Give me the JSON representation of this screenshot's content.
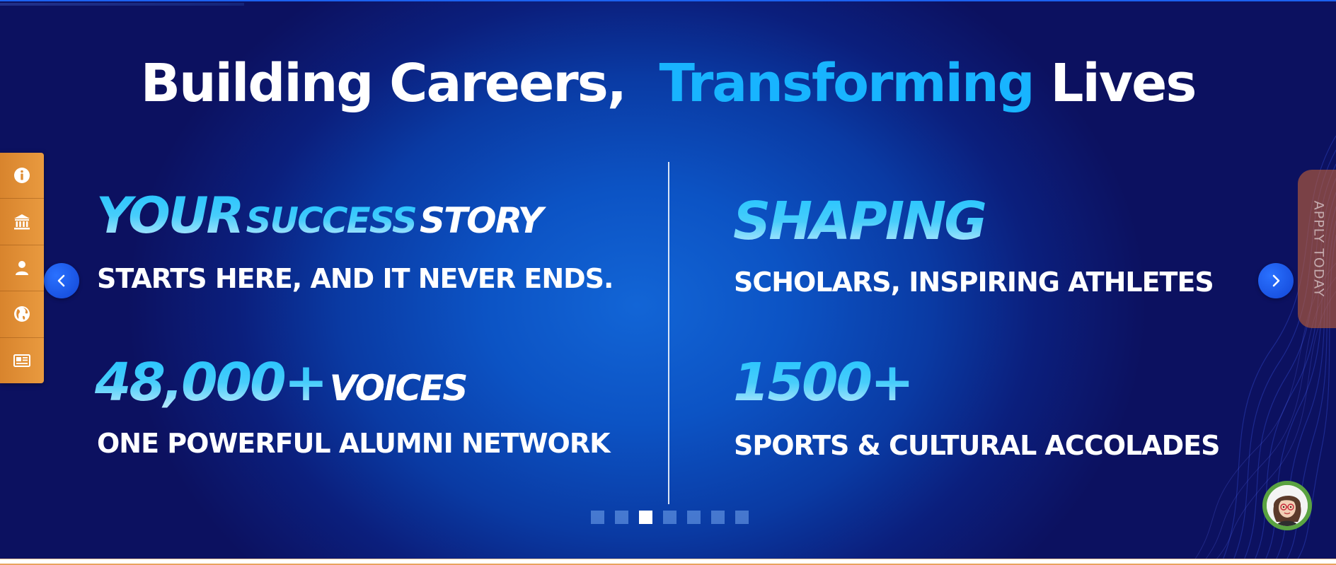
{
  "hero": {
    "headline": {
      "part1": "Building Careers,",
      "accent": "Transforming",
      "part2": "Lives"
    },
    "left": {
      "stat1": {
        "word1": "YOUR",
        "word2": "SUCCESS",
        "word3": "STORY",
        "subtitle": "STARTS HERE, AND IT NEVER ENDS."
      },
      "stat2": {
        "big": "48,000+",
        "word": "VOICES",
        "subtitle": "ONE POWERFUL ALUMNI NETWORK"
      }
    },
    "right": {
      "stat1": {
        "big": "SHAPING",
        "subtitle": "SCHOLARS, INSPIRING ATHLETES"
      },
      "stat2": {
        "big": "1500+",
        "subtitle": "SPORTS & CULTURAL ACCOLADES"
      }
    },
    "colors": {
      "accent": "#18b4ff",
      "toolbar": "#e08d35",
      "nav_button": "#1a55e6"
    }
  },
  "toolbar": {
    "items": [
      {
        "icon": "info-icon"
      },
      {
        "icon": "institution-icon"
      },
      {
        "icon": "user-icon"
      },
      {
        "icon": "globe-icon"
      },
      {
        "icon": "newspaper-icon"
      }
    ]
  },
  "apply": {
    "label": "APPLY TODAY"
  },
  "carousel": {
    "slide_count": 7,
    "active_index": 2
  }
}
